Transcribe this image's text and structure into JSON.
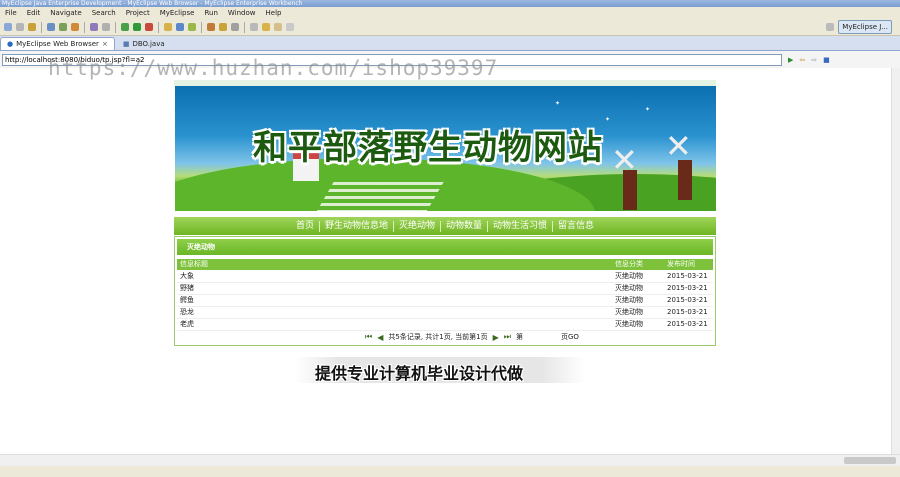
{
  "window": {
    "title": "MyEclipse Java Enterprise Development - MyEclipse Web Browser - MyEclipse Enterprise Workbench"
  },
  "menu": [
    "File",
    "Edit",
    "Navigate",
    "Search",
    "Project",
    "MyEclipse",
    "Run",
    "Window",
    "Help"
  ],
  "perspective": {
    "label": "MyEclipse J..."
  },
  "tabs": [
    {
      "label": "MyEclipse Web Browser",
      "active": true
    },
    {
      "label": "DBO.java",
      "active": false
    }
  ],
  "browser": {
    "url": "http://localhost:8080/biduo/tp.jsp?fl=a2"
  },
  "watermark": "https://www.huzhan.com/ishop39397",
  "site": {
    "title": "和平部落野生动物网站",
    "nav": [
      "首页",
      "野生动物信息地",
      "灭绝动物",
      "动物数量",
      "动物生活习惯",
      "留言信息"
    ],
    "section_title": "灭绝动物",
    "table": {
      "headers": [
        "信息标题",
        "信息分类",
        "发布时间"
      ],
      "rows": [
        {
          "title": "大象",
          "category": "灭绝动物",
          "date": "2015-03-21"
        },
        {
          "title": "野猪",
          "category": "灭绝动物",
          "date": "2015-03-21"
        },
        {
          "title": "鳄鱼",
          "category": "灭绝动物",
          "date": "2015-03-21"
        },
        {
          "title": "恐龙",
          "category": "灭绝动物",
          "date": "2015-03-21"
        },
        {
          "title": "老虎",
          "category": "灭绝动物",
          "date": "2015-03-21"
        }
      ]
    },
    "pager": {
      "info": "共5条记录, 共计1页, 当前第1页",
      "go_prefix": "第",
      "go_suffix": "页GO"
    }
  },
  "caption": "提供专业计算机毕业设计代做",
  "colors": {
    "nav_green": "#6fb522",
    "panel_green": "#7dc23a",
    "eclipse_chrome": "#ece9d8"
  }
}
